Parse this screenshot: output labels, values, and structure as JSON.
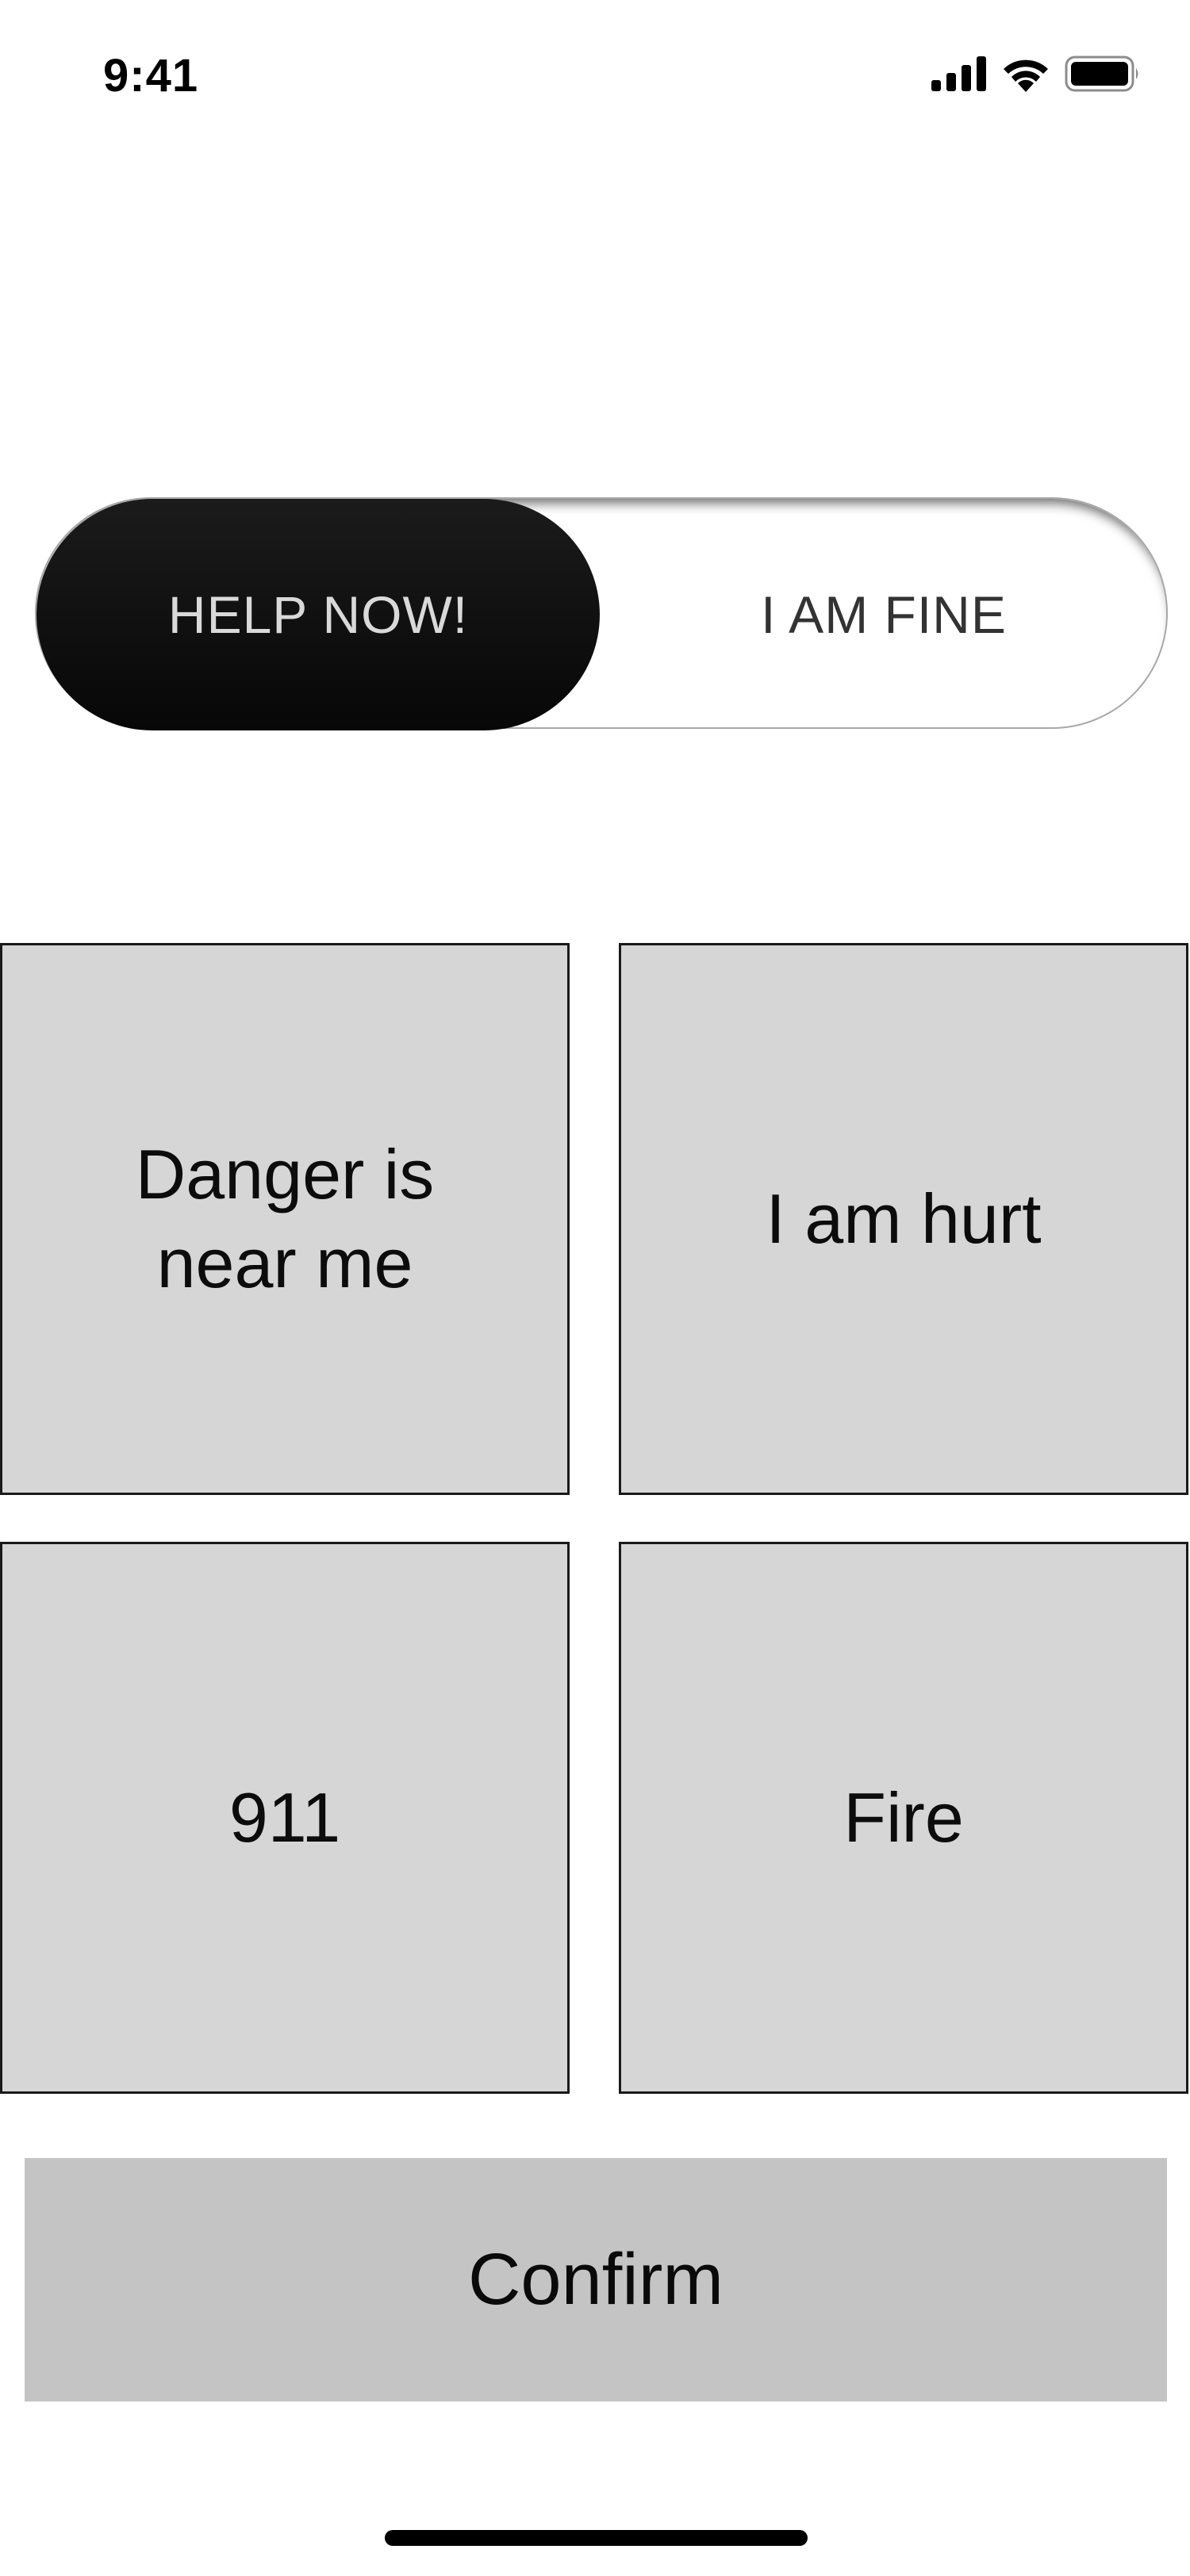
{
  "status_bar": {
    "time": "9:41"
  },
  "icons": {
    "signal": "cellular-signal-icon",
    "wifi": "wifi-icon",
    "battery": "battery-icon"
  },
  "toggle": {
    "help_label": "HELP NOW!",
    "fine_label": "I AM FINE",
    "selected": "HELP NOW!"
  },
  "options": [
    {
      "label": "Danger is near me"
    },
    {
      "label": "I am hurt"
    },
    {
      "label": "911"
    },
    {
      "label": "Fire"
    }
  ],
  "confirm_label": "Confirm",
  "colors": {
    "tile_background": "#d6d6d6",
    "toggle_active": "#111111",
    "confirm_background": "#c4c4c4"
  }
}
